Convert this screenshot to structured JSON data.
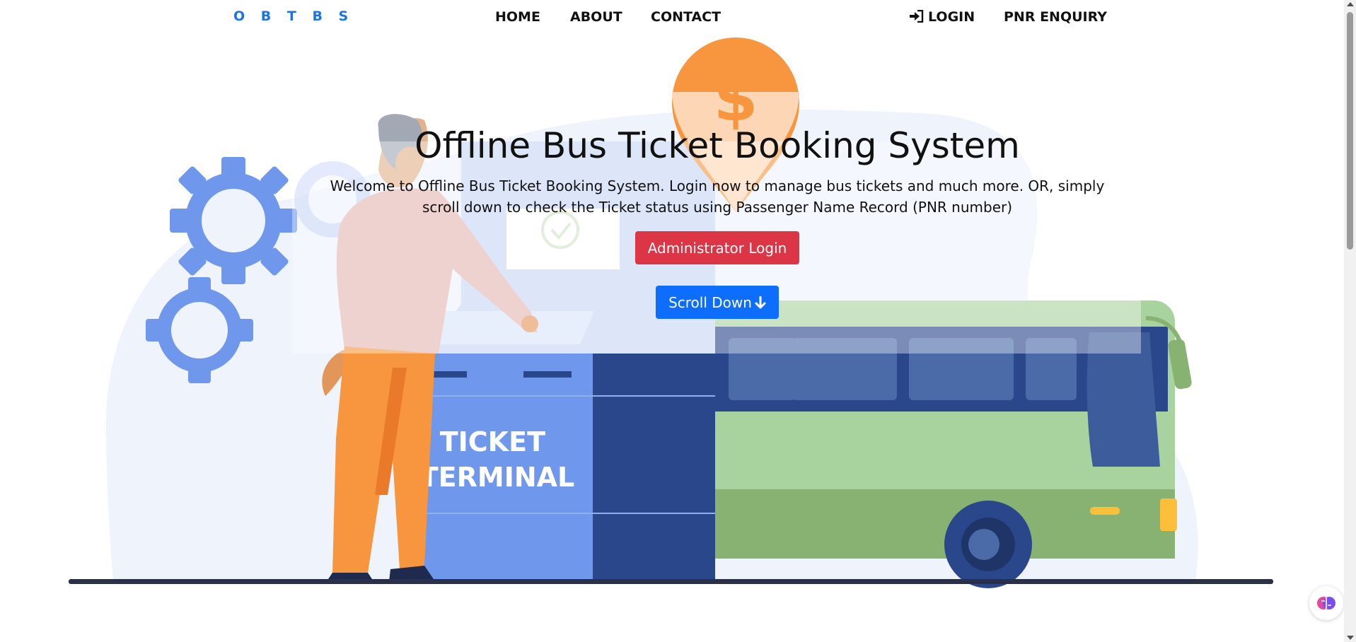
{
  "nav": {
    "brand": "O B T B S",
    "home": "HOME",
    "about": "ABOUT",
    "contact": "CONTACT",
    "login": "LOGIN",
    "pnr_enquiry": "PNR ENQUIRY",
    "login_icon": "sign-in-icon"
  },
  "hero": {
    "title": "Offline Bus Ticket Booking System",
    "text": "Welcome to Offline Bus Ticket Booking System. Login now to manage bus tickets and much more. OR, simply scroll down to check the Ticket status using Passenger Name Record (PNR number)",
    "admin_button": "Administrator Login",
    "scroll_button": "Scroll Down",
    "scroll_icon": "arrow-down-icon"
  },
  "illustration": {
    "terminal_label_line1": "TICKET",
    "terminal_label_line2": "TERMINAL",
    "pin_symbol": "$"
  },
  "colors": {
    "brand": "#1a73e8",
    "admin_button": "#dc3545",
    "scroll_button": "#0d6efd",
    "gear": "#6f98ec",
    "terminal_light": "#6f98ec",
    "terminal_dark": "#2b478b",
    "bus_green": "#a8d29e",
    "bus_dark_green": "#88b271",
    "pin_orange": "#f7963e",
    "ground": "#2a2f4a"
  },
  "widget": {
    "icon": "brain-icon"
  }
}
